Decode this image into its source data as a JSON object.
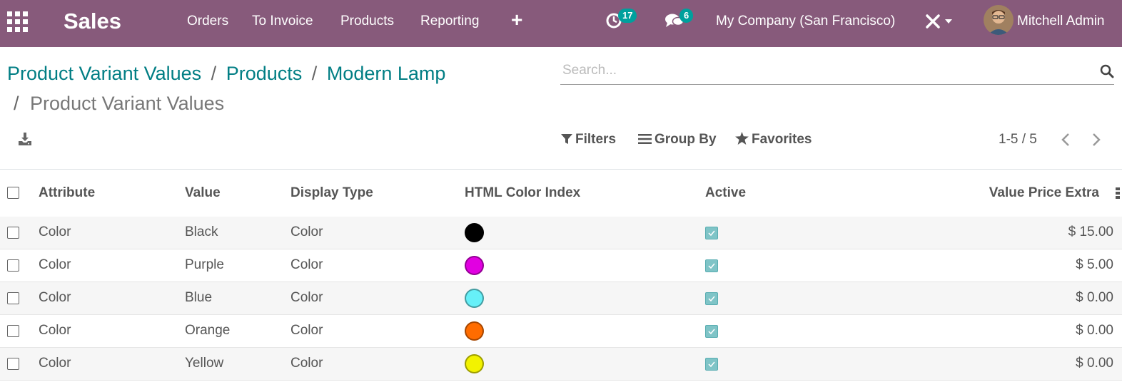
{
  "navbar": {
    "app_name": "Sales",
    "menu": [
      "Orders",
      "To Invoice",
      "Products",
      "Reporting"
    ],
    "activities_count": "17",
    "messages_count": "6",
    "company": "My Company (San Francisco)",
    "user": "Mitchell Admin",
    "color": "#875a7b"
  },
  "breadcrumb": {
    "items": [
      "Product Variant Values",
      "Products",
      "Modern Lamp"
    ],
    "separator": "/",
    "current": "Product Variant Values"
  },
  "search": {
    "placeholder": "Search..."
  },
  "controls": {
    "filters": "Filters",
    "group_by": "Group By",
    "favorites": "Favorites"
  },
  "pager": {
    "value": "1-5 / 5"
  },
  "table": {
    "columns": [
      "Attribute",
      "Value",
      "Display Type",
      "HTML Color Index",
      "Active",
      "Value Price Extra"
    ],
    "rows": [
      {
        "attribute": "Color",
        "value": "Black",
        "display_type": "Color",
        "color": "#000000",
        "active": true,
        "price_extra": "$ 15.00"
      },
      {
        "attribute": "Color",
        "value": "Purple",
        "display_type": "Color",
        "color": "#e100e1",
        "active": true,
        "price_extra": "$ 5.00"
      },
      {
        "attribute": "Color",
        "value": "Blue",
        "display_type": "Color",
        "color": "#66f0f8",
        "active": true,
        "price_extra": "$ 0.00"
      },
      {
        "attribute": "Color",
        "value": "Orange",
        "display_type": "Color",
        "color": "#ff6c00",
        "active": true,
        "price_extra": "$ 0.00"
      },
      {
        "attribute": "Color",
        "value": "Yellow",
        "display_type": "Color",
        "color": "#f2f200",
        "active": true,
        "price_extra": "$ 0.00"
      }
    ]
  },
  "theme": {
    "link_color": "#017e84",
    "badge_color": "#00a09d",
    "checkbox_active": "#7fc4c7"
  }
}
